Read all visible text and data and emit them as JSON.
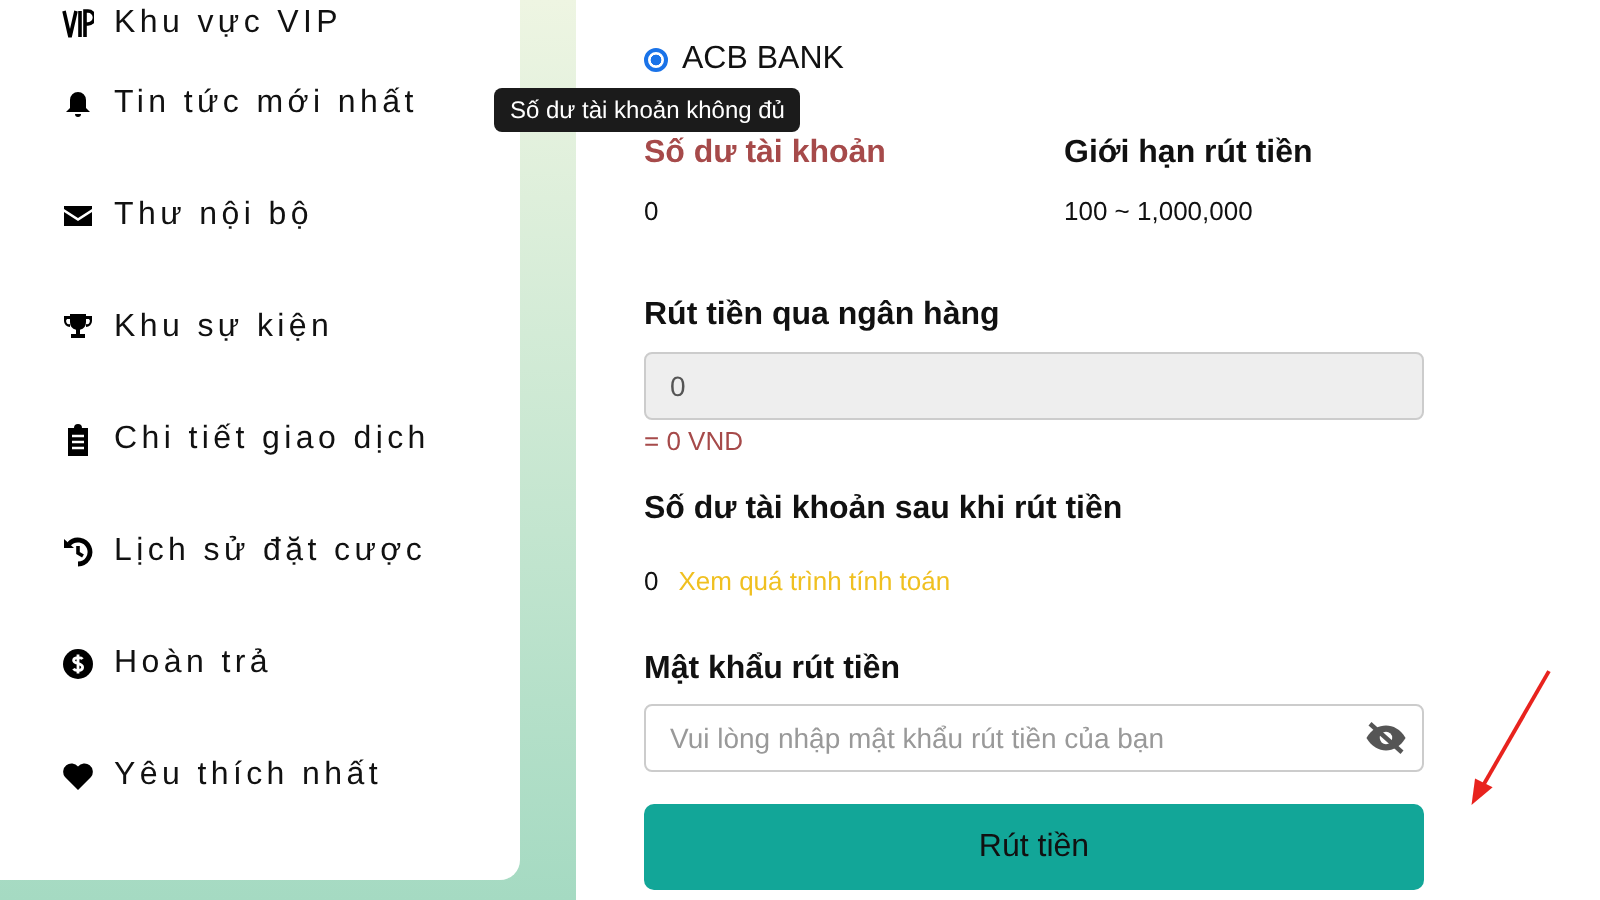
{
  "sidebar": {
    "items": [
      {
        "kind": "vip",
        "label": "Khu vực VIP"
      },
      {
        "kind": "news",
        "label": "Tin tức mới nhất"
      },
      {
        "kind": "mail",
        "label": "Thư nội bộ"
      },
      {
        "kind": "trophy",
        "label": "Khu sự kiện"
      },
      {
        "kind": "clipboard",
        "label": "Chi tiết giao dịch"
      },
      {
        "kind": "history",
        "label": "Lịch sử đặt cược"
      },
      {
        "kind": "dollar",
        "label": "Hoàn trả"
      },
      {
        "kind": "heart",
        "label": "Yêu thích nhất"
      }
    ]
  },
  "bank": {
    "label": "ACB BANK",
    "selected": true
  },
  "info": [
    {
      "label": "Số dư tài khoản",
      "value": "0",
      "warn": true
    },
    {
      "label": "Giới hạn rút tiền",
      "value": "100 ~ 1,000,000",
      "warn": false
    }
  ],
  "tooltip": "Số dư tài khoản không đủ",
  "amount": {
    "label": "Rút tiền qua ngân hàng",
    "value": "0",
    "converted": "= 0 VND"
  },
  "after": {
    "label": "Số dư tài khoản sau khi rút tiền",
    "value": "0",
    "link": "Xem quá trình tính toán"
  },
  "password": {
    "label": "Mật khẩu rút tiền",
    "placeholder": "Vui lòng nhập mật khẩu rút tiền của bạn"
  },
  "submit": "Rút tiền"
}
